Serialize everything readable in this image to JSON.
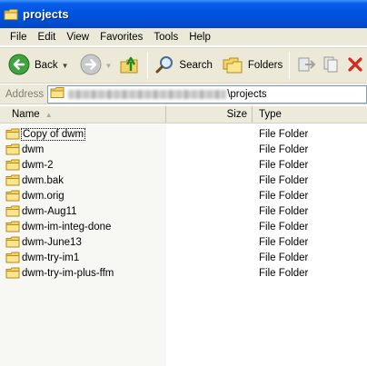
{
  "window": {
    "title": "projects"
  },
  "menu": [
    "File",
    "Edit",
    "View",
    "Favorites",
    "Tools",
    "Help"
  ],
  "toolbar": {
    "back": "Back",
    "search": "Search",
    "folders": "Folders"
  },
  "address": {
    "label": "Address",
    "path_suffix": "\\projects"
  },
  "columns": {
    "name": "Name",
    "size": "Size",
    "type": "Type"
  },
  "files": [
    {
      "name": "Copy of dwm",
      "type": "File Folder"
    },
    {
      "name": "dwm",
      "type": "File Folder"
    },
    {
      "name": "dwm-2",
      "type": "File Folder"
    },
    {
      "name": "dwm.bak",
      "type": "File Folder"
    },
    {
      "name": "dwm.orig",
      "type": "File Folder"
    },
    {
      "name": "dwm-Aug11",
      "type": "File Folder"
    },
    {
      "name": "dwm-im-integ-done",
      "type": "File Folder"
    },
    {
      "name": "dwm-June13",
      "type": "File Folder"
    },
    {
      "name": "dwm-try-im1",
      "type": "File Folder"
    },
    {
      "name": "dwm-try-im-plus-ffm",
      "type": "File Folder"
    }
  ]
}
